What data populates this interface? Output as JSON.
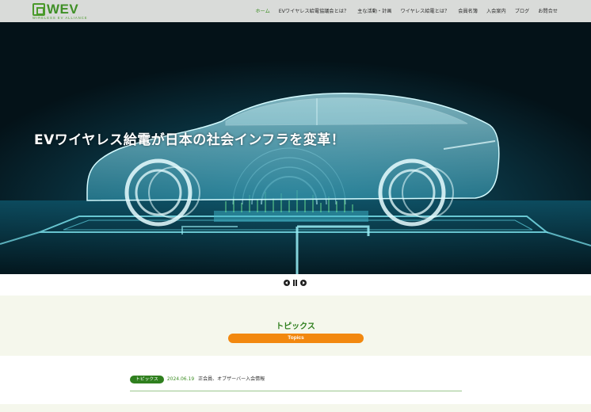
{
  "brand": {
    "logo_text": "WEV",
    "logo_sub": "WIRELESS EV ALLIANCE",
    "accent": "#3f8f26",
    "pill_color": "#f2880f"
  },
  "nav": {
    "items": [
      {
        "label": "ホーム",
        "active": true
      },
      {
        "label": "EVワイヤレス給電協議会とは？"
      },
      {
        "label": "主な活動・計画"
      },
      {
        "label": "ワイヤレス給電とは？"
      },
      {
        "label": "会員名簿"
      },
      {
        "label": "入会案内"
      },
      {
        "label": "ブログ"
      },
      {
        "label": "お問合せ"
      }
    ]
  },
  "hero": {
    "title": "EVワイヤレス給電が日本の社会インフラを変革！"
  },
  "slider": {
    "prev_icon": "prev-icon",
    "pause_icon": "pause-icon",
    "next_icon": "next-icon"
  },
  "topics": {
    "title": "トピックス",
    "pill": "Topics"
  },
  "news": [
    {
      "badge": "トピックス",
      "date": "2024.06.19",
      "text": "正会員、オブザーバー入会情報"
    }
  ]
}
